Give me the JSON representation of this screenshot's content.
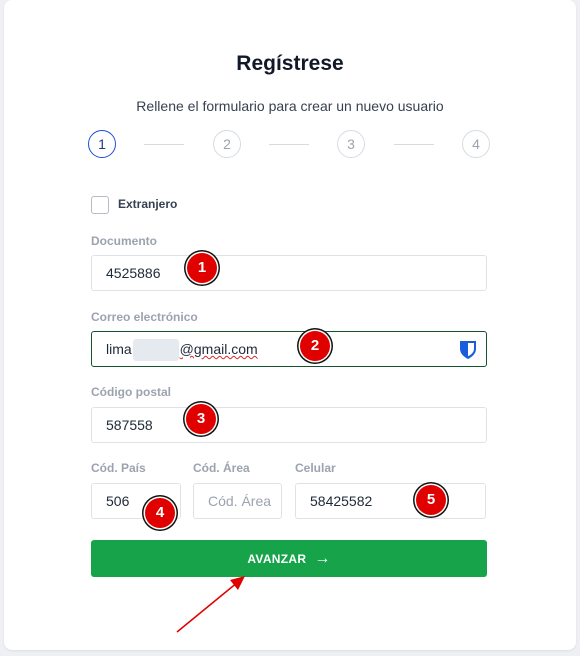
{
  "form": {
    "title": "Regístrese",
    "subtitle": "Rellene el formulario para crear un nuevo usuario",
    "steps": [
      "1",
      "2",
      "3",
      "4"
    ],
    "active_step": "1",
    "foreigner_checkbox": {
      "label": "Extranjero",
      "checked": false
    },
    "document": {
      "label": "Documento",
      "value": "4525886"
    },
    "email": {
      "label": "Correo electrónico",
      "value_prefix": "lima",
      "value_suffix": "@gmail.com",
      "autofill_icon": "bitwarden-shield-icon"
    },
    "postal_code": {
      "label": "Código postal",
      "value": "587558"
    },
    "country_code": {
      "label": "Cód. País",
      "value": "506"
    },
    "area_code": {
      "label": "Cód. Área",
      "placeholder": "Cód. Área"
    },
    "mobile": {
      "label": "Celular",
      "value": "58425582"
    },
    "submit": {
      "label": "AVANZAR",
      "icon": "arrow-right-icon"
    }
  },
  "annotations": {
    "badges": [
      "1",
      "2",
      "3",
      "4",
      "5"
    ],
    "color": "#e00000"
  },
  "colors": {
    "accent_green": "#16a34a",
    "step_active": "#1d4ed8"
  }
}
